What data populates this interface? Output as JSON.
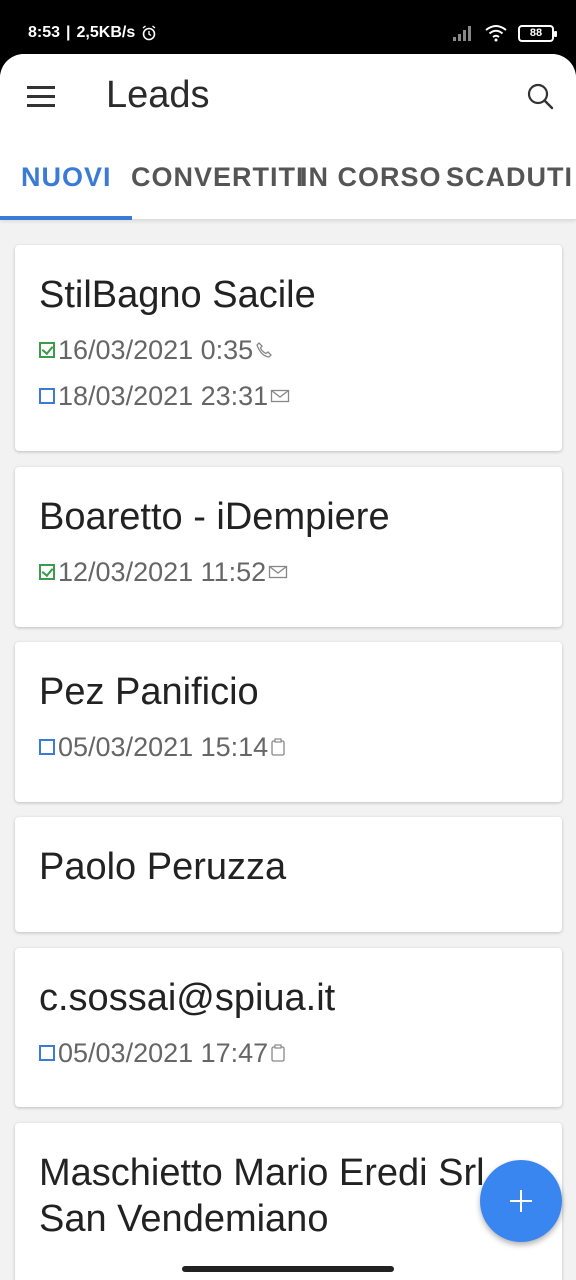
{
  "status": {
    "time": "8:53",
    "speed": "2,5KB/s",
    "battery": "88"
  },
  "appbar": {
    "title": "Leads"
  },
  "tabs": [
    {
      "label": "NUOVI",
      "active": true
    },
    {
      "label": "CONVERTITI",
      "active": false
    },
    {
      "label": "IN CORSO",
      "active": false
    },
    {
      "label": "SCADUTI",
      "active": false
    }
  ],
  "leads": [
    {
      "name": "StilBagno Sacile",
      "activities": [
        {
          "done": true,
          "datetime": "16/03/2021 0:35",
          "type": "phone-icon"
        },
        {
          "done": false,
          "datetime": "18/03/2021 23:31",
          "type": "mail-icon"
        }
      ]
    },
    {
      "name": "Boaretto - iDempiere",
      "activities": [
        {
          "done": true,
          "datetime": "12/03/2021 11:52",
          "type": "mail-icon"
        }
      ]
    },
    {
      "name": "Pez Panificio",
      "activities": [
        {
          "done": false,
          "datetime": "05/03/2021 15:14",
          "type": "task-icon"
        }
      ]
    },
    {
      "name": "Paolo Peruzza",
      "activities": []
    },
    {
      "name": "c.sossai@spiua.it",
      "activities": [
        {
          "done": false,
          "datetime": "05/03/2021 17:47",
          "type": "task-icon"
        }
      ]
    },
    {
      "name": "Maschietto Mario Eredi Srl - San Vendemiano",
      "activities": []
    }
  ],
  "colors": {
    "accent": "#3a7bd5",
    "fab": "#3a86f0",
    "done": "#3a9b4a"
  }
}
